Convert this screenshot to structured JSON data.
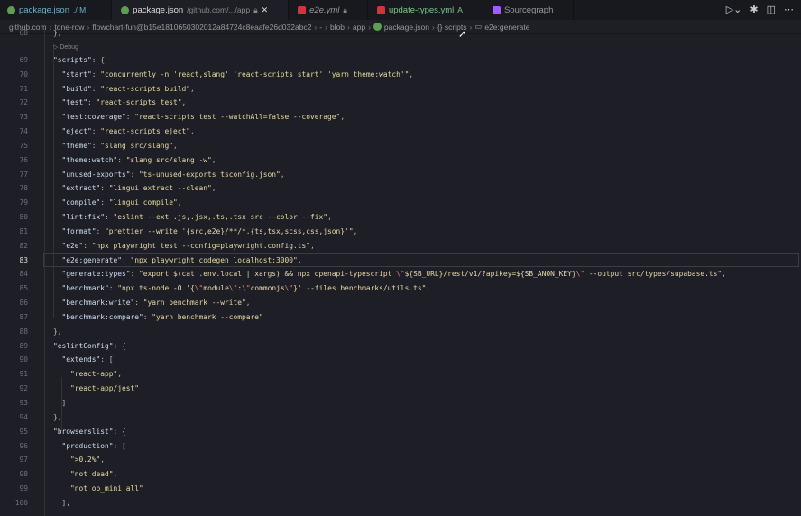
{
  "tabs": [
    {
      "label": "package.json",
      "detail": "./ M",
      "color": "#6fb1c9",
      "icon": "node-icon",
      "active": false
    },
    {
      "label": "package.json",
      "detail": "/github.com/.../app",
      "color": "#ddd",
      "icon": "node-icon",
      "active": true,
      "locked": true
    },
    {
      "label": "e2e.yml",
      "detail": "",
      "color": "#999",
      "icon": "yaml-icon",
      "active": false,
      "locked": true
    },
    {
      "label": "update-types.yml",
      "detail": "A",
      "color": "#7fc48a",
      "icon": "yaml-icon",
      "active": false
    },
    {
      "label": "Sourcegraph",
      "detail": "",
      "color": "#999",
      "icon": "sourcegraph-icon",
      "active": false
    }
  ],
  "breadcrumb": [
    "github.com",
    "tone-row",
    "flowchart-fun@b15e1810650302012a84724c8eaafe26d032abc2",
    "-",
    "blob",
    "app",
    "package.json",
    "{} scripts",
    "e2e:generate"
  ],
  "codelens": "▷ Debug",
  "current_line": 83,
  "lines": [
    {
      "n": 68,
      "t": "},",
      "i": 0
    },
    {
      "n": 69,
      "t": "\"scripts\": {",
      "i": 0
    },
    {
      "n": 70,
      "t": "\"start\": \"concurrently -n 'react,slang' 'react-scripts start' 'yarn theme:watch'\",",
      "i": 1
    },
    {
      "n": 71,
      "t": "\"build\": \"react-scripts build\",",
      "i": 1
    },
    {
      "n": 72,
      "t": "\"test\": \"react-scripts test\",",
      "i": 1
    },
    {
      "n": 73,
      "t": "\"test:coverage\": \"react-scripts test --watchAll=false --coverage\",",
      "i": 1
    },
    {
      "n": 74,
      "t": "\"eject\": \"react-scripts eject\",",
      "i": 1
    },
    {
      "n": 75,
      "t": "\"theme\": \"slang src/slang\",",
      "i": 1
    },
    {
      "n": 76,
      "t": "\"theme:watch\": \"slang src/slang -w\",",
      "i": 1
    },
    {
      "n": 77,
      "t": "\"unused-exports\": \"ts-unused-exports tsconfig.json\",",
      "i": 1
    },
    {
      "n": 78,
      "t": "\"extract\": \"lingui extract --clean\",",
      "i": 1
    },
    {
      "n": 79,
      "t": "\"compile\": \"lingui compile\",",
      "i": 1
    },
    {
      "n": 80,
      "t": "\"lint:fix\": \"eslint --ext .js,.jsx,.ts,.tsx src --color --fix\",",
      "i": 1
    },
    {
      "n": 81,
      "t": "\"format\": \"prettier --write '{src,e2e}/**/*.{ts,tsx,scss,css,json}'\",",
      "i": 1
    },
    {
      "n": 82,
      "t": "\"e2e\": \"npx playwright test --config=playwright.config.ts\",",
      "i": 1
    },
    {
      "n": 83,
      "t": "\"e2e:generate\": \"npx playwright codegen localhost:3000\",",
      "i": 1
    },
    {
      "n": 84,
      "t": "\"generate:types\": \"export $(cat .env.local | xargs) && npx openapi-typescript \\\"${SB_URL}/rest/v1/?apikey=${SB_ANON_KEY}\\\" --output src/types/supabase.ts\",",
      "i": 1
    },
    {
      "n": 85,
      "t": "\"benchmark\": \"npx ts-node -O '{\\\"module\\\":\\\"commonjs\\\"}' --files benchmarks/utils.ts\",",
      "i": 1
    },
    {
      "n": 86,
      "t": "\"benchmark:write\": \"yarn benchmark --write\",",
      "i": 1
    },
    {
      "n": 87,
      "t": "\"benchmark:compare\": \"yarn benchmark --compare\"",
      "i": 1
    },
    {
      "n": 88,
      "t": "},",
      "i": 0
    },
    {
      "n": 89,
      "t": "\"eslintConfig\": {",
      "i": 0
    },
    {
      "n": 90,
      "t": "\"extends\": [",
      "i": 1
    },
    {
      "n": 91,
      "t": "\"react-app\",",
      "i": 2
    },
    {
      "n": 92,
      "t": "\"react-app/jest\"",
      "i": 2
    },
    {
      "n": 93,
      "t": "]",
      "i": 1
    },
    {
      "n": 94,
      "t": "},",
      "i": 0
    },
    {
      "n": 95,
      "t": "\"browserslist\": {",
      "i": 0
    },
    {
      "n": 96,
      "t": "\"production\": [",
      "i": 1
    },
    {
      "n": 97,
      "t": "\">0.2%\",",
      "i": 2
    },
    {
      "n": 98,
      "t": "\"not dead\",",
      "i": 2
    },
    {
      "n": 99,
      "t": "\"not op_mini all\"",
      "i": 2
    },
    {
      "n": 100,
      "t": "],",
      "i": 1
    }
  ]
}
